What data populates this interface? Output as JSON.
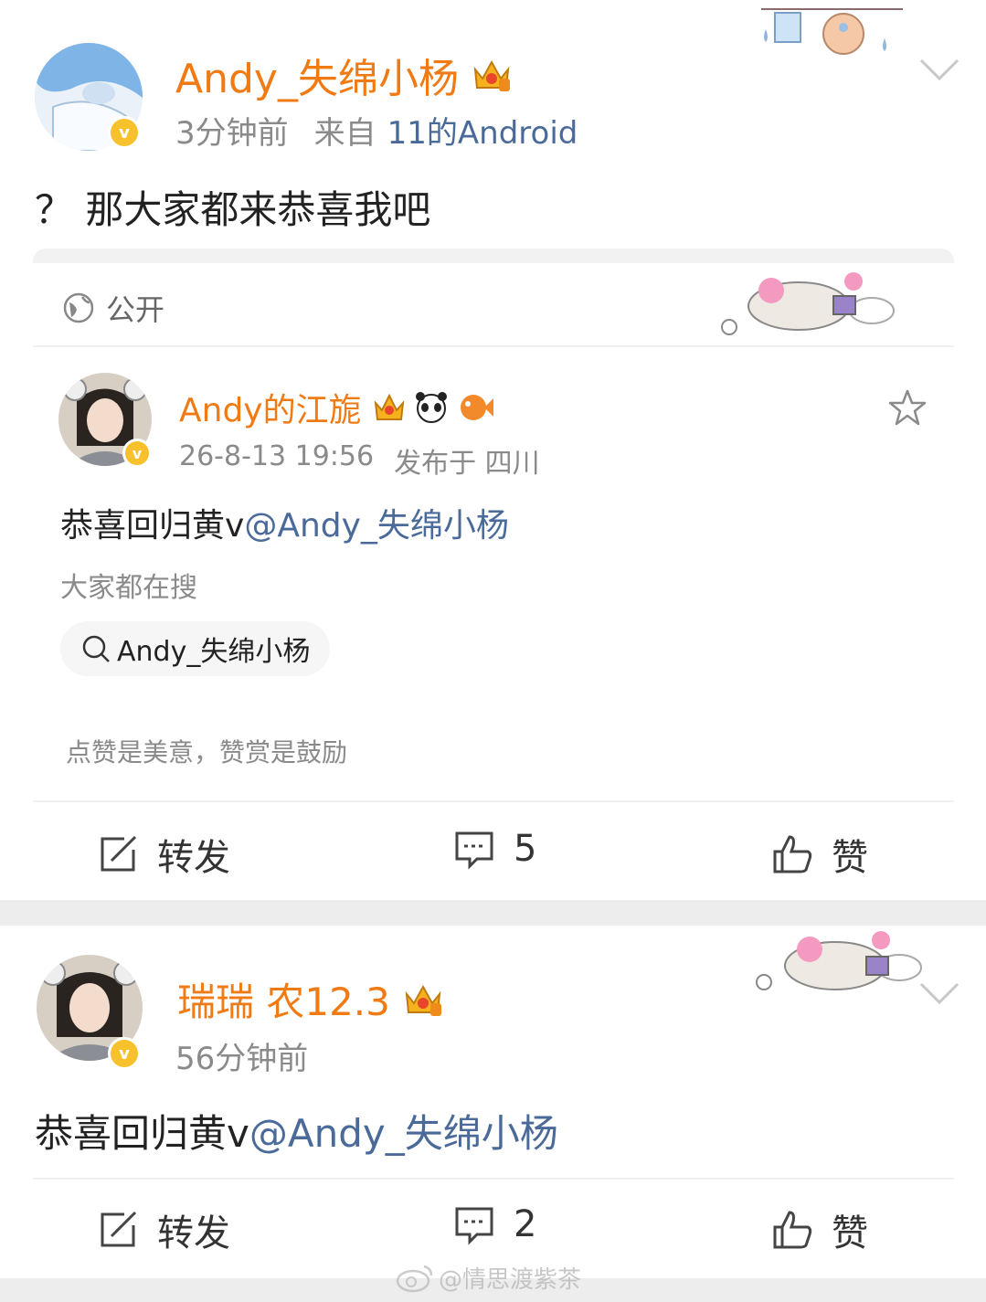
{
  "post1": {
    "username": "Andy_失绵小杨",
    "time": "3分钟前",
    "source_prefix": "来自",
    "source": "11的Android",
    "text": "？ 那大家都来恭喜我吧",
    "visibility": "公开",
    "repost": {
      "username": "Andy的江旎",
      "datetime": "26-8-13 19:56",
      "location": "发布于 四川",
      "text_main": "恭喜回归黄v",
      "mention": "@Andy_失绵小杨",
      "search_hint": "大家都在搜",
      "search_term": "Andy_失绵小杨",
      "footer_note": "点赞是美意，赞赏是鼓励"
    },
    "actions": {
      "repost_label": "转发",
      "comment_count": "5",
      "like_label": "赞"
    }
  },
  "post2": {
    "username": "瑞瑞 农12.3",
    "time": "56分钟前",
    "text_main": "恭喜回归黄v",
    "mention": "@Andy_失绵小杨",
    "actions": {
      "repost_label": "转发",
      "comment_count": "2",
      "like_label": "赞"
    }
  },
  "watermark": "@情思渡紫茶",
  "colors": {
    "username": "#f07a14",
    "link": "#4a6a9a",
    "badge": "#f6c12c"
  }
}
